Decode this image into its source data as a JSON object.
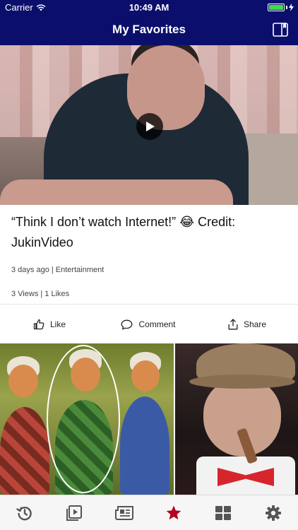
{
  "status_bar": {
    "carrier": "Carrier",
    "time": "10:49 AM",
    "battery_level": 1.0
  },
  "nav": {
    "title": "My Favorites",
    "right_icon": "book-icon"
  },
  "colors": {
    "nav_background": "#0b0f6b",
    "accent": "#b30022",
    "battery_fill": "#3ddc4a"
  },
  "post": {
    "title": "“Think I don’t watch Internet!” 😂 Credit: JukinVideo",
    "meta_time_category": "3 days ago | Entertainment",
    "meta_counts": "3 Views | 1 Likes"
  },
  "actions": {
    "like": "Like",
    "comment": "Comment",
    "share": "Share"
  },
  "tabbar": {
    "items": [
      {
        "icon": "history-icon",
        "selected": false
      },
      {
        "icon": "video-icon",
        "selected": false
      },
      {
        "icon": "news-icon",
        "selected": false
      },
      {
        "icon": "star-icon",
        "selected": true
      },
      {
        "icon": "grid-icon",
        "selected": false
      },
      {
        "icon": "gear-icon",
        "selected": false
      }
    ]
  }
}
